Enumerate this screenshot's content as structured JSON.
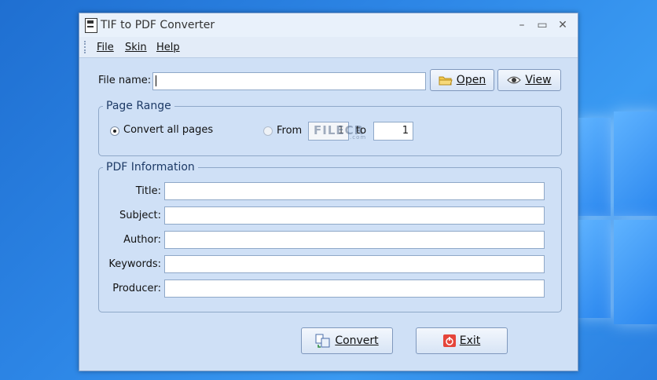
{
  "window": {
    "title": "TIF to PDF Converter",
    "minimize": "–",
    "maximize": "▭",
    "close": "✕"
  },
  "menu": {
    "items": [
      "File",
      "Skin",
      "Help"
    ]
  },
  "file": {
    "label": "File name:",
    "value": "",
    "open_label": "Open",
    "view_label": "View"
  },
  "page_range": {
    "title": "Page Range",
    "convert_all_label": "Convert all pages",
    "from_label": "From",
    "to_label": "to",
    "from_value": "1",
    "to_value": "1",
    "selected": "convert_all"
  },
  "watermark": {
    "text": "FILECR",
    "sub": ".com"
  },
  "pdf_info": {
    "title": "PDF Information",
    "fields": [
      {
        "label": "Title:",
        "value": ""
      },
      {
        "label": "Subject:",
        "value": ""
      },
      {
        "label": "Author:",
        "value": ""
      },
      {
        "label": "Keywords:",
        "value": ""
      },
      {
        "label": "Producer:",
        "value": ""
      }
    ]
  },
  "actions": {
    "convert_label": "Convert",
    "exit_label": "Exit"
  },
  "colors": {
    "window_bg": "#cfe0f6",
    "desktop": "#2d86e6",
    "exit_icon": "#e5453a"
  }
}
